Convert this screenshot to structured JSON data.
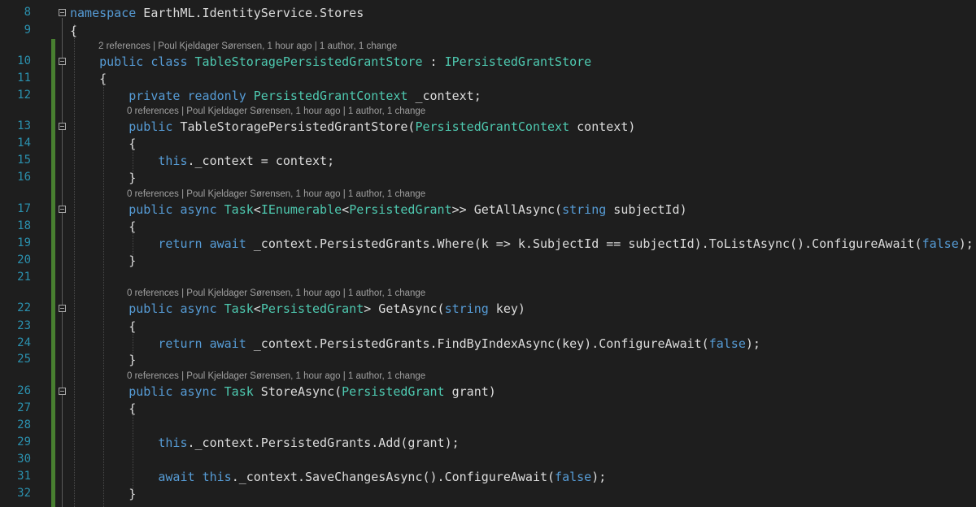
{
  "editor": {
    "theme": {
      "background": "#1e1e1e",
      "keyword": "#569cd6",
      "type": "#4ec9b0",
      "text": "#dcdcdc",
      "line_number": "#2b91af",
      "codelens": "#a0a0a0",
      "change_bar": "#487f30"
    },
    "codelens": {
      "class": "2 references | Poul Kjeldager Sørensen, 1 hour ago | 1 author, 1 change",
      "ctor": "0 references | Poul Kjeldager Sørensen, 1 hour ago | 1 author, 1 change",
      "get_all": "0 references | Poul Kjeldager Sørensen, 1 hour ago | 1 author, 1 change",
      "get": "0 references | Poul Kjeldager Sørensen, 1 hour ago | 1 author, 1 change",
      "store": "0 references | Poul Kjeldager Sørensen, 1 hour ago | 1 author, 1 change"
    },
    "lines": [
      {
        "num": "8",
        "tokens": [
          {
            "t": "namespace",
            "c": "kw"
          },
          {
            "t": " EarthML.IdentityService.Stores",
            "c": "tx"
          }
        ]
      },
      {
        "num": "9",
        "tokens": [
          {
            "t": "{",
            "c": "tx"
          }
        ]
      },
      {
        "num": "10",
        "tokens": [
          {
            "t": "    ",
            "c": "tx"
          },
          {
            "t": "public",
            "c": "kw"
          },
          {
            "t": " ",
            "c": "tx"
          },
          {
            "t": "class",
            "c": "kw"
          },
          {
            "t": " ",
            "c": "tx"
          },
          {
            "t": "TableStoragePersistedGrantStore",
            "c": "ty"
          },
          {
            "t": " : ",
            "c": "tx"
          },
          {
            "t": "IPersistedGrantStore",
            "c": "ty"
          }
        ]
      },
      {
        "num": "11",
        "tokens": [
          {
            "t": "    {",
            "c": "tx"
          }
        ]
      },
      {
        "num": "12",
        "tokens": [
          {
            "t": "        ",
            "c": "tx"
          },
          {
            "t": "private",
            "c": "kw"
          },
          {
            "t": " ",
            "c": "tx"
          },
          {
            "t": "readonly",
            "c": "kw"
          },
          {
            "t": " ",
            "c": "tx"
          },
          {
            "t": "PersistedGrantContext",
            "c": "ty"
          },
          {
            "t": " _context;",
            "c": "tx"
          }
        ]
      },
      {
        "num": "13",
        "tokens": [
          {
            "t": "        ",
            "c": "tx"
          },
          {
            "t": "public",
            "c": "kw"
          },
          {
            "t": " TableStoragePersistedGrantStore(",
            "c": "tx"
          },
          {
            "t": "PersistedGrantContext",
            "c": "ty"
          },
          {
            "t": " context)",
            "c": "tx"
          }
        ]
      },
      {
        "num": "14",
        "tokens": [
          {
            "t": "        {",
            "c": "tx"
          }
        ]
      },
      {
        "num": "15",
        "tokens": [
          {
            "t": "            ",
            "c": "tx"
          },
          {
            "t": "this",
            "c": "kw"
          },
          {
            "t": "._context = context;",
            "c": "tx"
          }
        ]
      },
      {
        "num": "16",
        "tokens": [
          {
            "t": "        }",
            "c": "tx"
          }
        ]
      },
      {
        "num": "17",
        "tokens": [
          {
            "t": "        ",
            "c": "tx"
          },
          {
            "t": "public",
            "c": "kw"
          },
          {
            "t": " ",
            "c": "tx"
          },
          {
            "t": "async",
            "c": "kw"
          },
          {
            "t": " ",
            "c": "tx"
          },
          {
            "t": "Task",
            "c": "ty"
          },
          {
            "t": "<",
            "c": "tx"
          },
          {
            "t": "IEnumerable",
            "c": "ty"
          },
          {
            "t": "<",
            "c": "tx"
          },
          {
            "t": "PersistedGrant",
            "c": "ty"
          },
          {
            "t": ">> GetAllAsync(",
            "c": "tx"
          },
          {
            "t": "string",
            "c": "kw"
          },
          {
            "t": " subjectId)",
            "c": "tx"
          }
        ]
      },
      {
        "num": "18",
        "tokens": [
          {
            "t": "        {",
            "c": "tx"
          }
        ]
      },
      {
        "num": "19",
        "tokens": [
          {
            "t": "            ",
            "c": "tx"
          },
          {
            "t": "return",
            "c": "kw"
          },
          {
            "t": " ",
            "c": "tx"
          },
          {
            "t": "await",
            "c": "kw"
          },
          {
            "t": " _context.PersistedGrants.Where(k => k.SubjectId == subjectId).ToListAsync().ConfigureAwait(",
            "c": "tx"
          },
          {
            "t": "false",
            "c": "kw"
          },
          {
            "t": ");",
            "c": "tx"
          }
        ]
      },
      {
        "num": "20",
        "tokens": [
          {
            "t": "        }",
            "c": "tx"
          }
        ]
      },
      {
        "num": "21",
        "tokens": []
      },
      {
        "num": "22",
        "tokens": [
          {
            "t": "        ",
            "c": "tx"
          },
          {
            "t": "public",
            "c": "kw"
          },
          {
            "t": " ",
            "c": "tx"
          },
          {
            "t": "async",
            "c": "kw"
          },
          {
            "t": " ",
            "c": "tx"
          },
          {
            "t": "Task",
            "c": "ty"
          },
          {
            "t": "<",
            "c": "tx"
          },
          {
            "t": "PersistedGrant",
            "c": "ty"
          },
          {
            "t": "> GetAsync(",
            "c": "tx"
          },
          {
            "t": "string",
            "c": "kw"
          },
          {
            "t": " key)",
            "c": "tx"
          }
        ]
      },
      {
        "num": "23",
        "tokens": [
          {
            "t": "        {",
            "c": "tx"
          }
        ]
      },
      {
        "num": "24",
        "tokens": [
          {
            "t": "            ",
            "c": "tx"
          },
          {
            "t": "return",
            "c": "kw"
          },
          {
            "t": " ",
            "c": "tx"
          },
          {
            "t": "await",
            "c": "kw"
          },
          {
            "t": " _context.PersistedGrants.FindByIndexAsync(key).ConfigureAwait(",
            "c": "tx"
          },
          {
            "t": "false",
            "c": "kw"
          },
          {
            "t": ");",
            "c": "tx"
          }
        ]
      },
      {
        "num": "25",
        "tokens": [
          {
            "t": "        }",
            "c": "tx"
          }
        ]
      },
      {
        "num": "26",
        "tokens": [
          {
            "t": "        ",
            "c": "tx"
          },
          {
            "t": "public",
            "c": "kw"
          },
          {
            "t": " ",
            "c": "tx"
          },
          {
            "t": "async",
            "c": "kw"
          },
          {
            "t": " ",
            "c": "tx"
          },
          {
            "t": "Task",
            "c": "ty"
          },
          {
            "t": " StoreAsync(",
            "c": "tx"
          },
          {
            "t": "PersistedGrant",
            "c": "ty"
          },
          {
            "t": " grant)",
            "c": "tx"
          }
        ]
      },
      {
        "num": "27",
        "tokens": [
          {
            "t": "        {",
            "c": "tx"
          }
        ]
      },
      {
        "num": "28",
        "tokens": []
      },
      {
        "num": "29",
        "tokens": [
          {
            "t": "            ",
            "c": "tx"
          },
          {
            "t": "this",
            "c": "kw"
          },
          {
            "t": "._context.PersistedGrants.Add(grant);",
            "c": "tx"
          }
        ]
      },
      {
        "num": "30",
        "tokens": []
      },
      {
        "num": "31",
        "tokens": [
          {
            "t": "            ",
            "c": "tx"
          },
          {
            "t": "await",
            "c": "kw"
          },
          {
            "t": " ",
            "c": "tx"
          },
          {
            "t": "this",
            "c": "kw"
          },
          {
            "t": "._context.SaveChangesAsync().ConfigureAwait(",
            "c": "tx"
          },
          {
            "t": "false",
            "c": "kw"
          },
          {
            "t": ");",
            "c": "tx"
          }
        ]
      },
      {
        "num": "32",
        "tokens": [
          {
            "t": "        }",
            "c": "tx"
          }
        ]
      }
    ]
  }
}
